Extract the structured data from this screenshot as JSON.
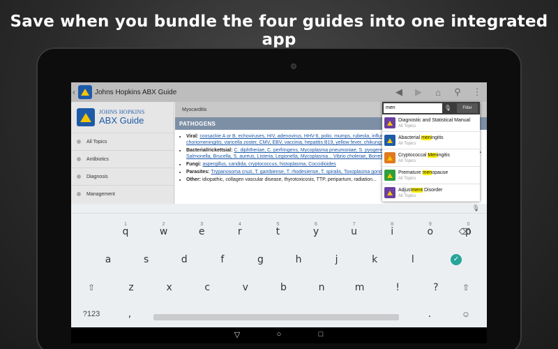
{
  "headline": "Save when you bundle the four guides into one integrated app",
  "appbar": {
    "title": "Johns Hopkins ABX Guide"
  },
  "brand": {
    "line1": "JOHNS HOPKINS",
    "line2": "ABX Guide"
  },
  "sidebar": {
    "items": [
      {
        "label": "All Topics"
      },
      {
        "label": "Antibiotics"
      },
      {
        "label": "Diagnosis"
      },
      {
        "label": "Management"
      }
    ]
  },
  "content": {
    "crumb": "Myocarditis",
    "section": "PATHOGENS",
    "bullets": [
      {
        "label": "Viral:",
        "text": "coxsackie A or B, echoviruses, HIV, adenovirus, HHV-6, polio, mumps, rubeola, influenza, rubella, dengue, lymphocytic choriomeningitis, varicella zoster, CMV, EBV, vaccinia, hepatitis B19, yellow fever, chikungunya virus."
      },
      {
        "label": "Bacterial/rickettsial:",
        "text": "C. diphtheriae, C. perfringens, Mycoplasma pneumoniae, S. pyogenes, R. rickettsii (RMSF Fever), N. meningitidis, Salmonella, Brucella, S. aureus, Listeria, Legionella, Mycoplasma... Vibrio cholerae, Borrelia burgdorferi."
      },
      {
        "label": "Fungi:",
        "text": "aspergillus, candida, cryptococcus, histoplasma, Coccidioides"
      },
      {
        "label": "Parasites:",
        "text": "Trypanosoma cruzi, T. gambiense, T. rhodesiense, T. spiralis, Toxoplasma gondii... migrans"
      },
      {
        "label": "Other:",
        "text": "idiopathic, collagen vascular disease, thyrotoxicosis, TTP, peripartum, radiation..."
      }
    ]
  },
  "search": {
    "query": "men",
    "filter_label": "Filter",
    "results": [
      {
        "pre": "Diagnostic and Statistical Manual",
        "hl": "",
        "post": "",
        "sub": "All Topics",
        "color": "#6a3fa0"
      },
      {
        "pre": "Abacterial ",
        "hl": "men",
        "post": "ingitis",
        "sub": "All Topics",
        "color": "#1e5aa8"
      },
      {
        "pre": "Cryptococcal ",
        "hl": "Men",
        "post": "ingitis",
        "sub": "All Topics",
        "color": "#e07a1f"
      },
      {
        "pre": "Premature ",
        "hl": "men",
        "post": "opause",
        "sub": "All Topics",
        "color": "#2e9e3e"
      },
      {
        "pre": "Adjust",
        "hl": "ment",
        "post": " Disorder",
        "sub": "All Topics",
        "color": "#6a3fa0"
      }
    ]
  },
  "keyboard": {
    "row1": [
      {
        "k": "q",
        "h": "1"
      },
      {
        "k": "w",
        "h": "2"
      },
      {
        "k": "e",
        "h": "3"
      },
      {
        "k": "r",
        "h": "4"
      },
      {
        "k": "t",
        "h": "5"
      },
      {
        "k": "y",
        "h": "6"
      },
      {
        "k": "u",
        "h": "7"
      },
      {
        "k": "i",
        "h": "8"
      },
      {
        "k": "o",
        "h": "9"
      },
      {
        "k": "p",
        "h": "0"
      }
    ],
    "row2": [
      "a",
      "s",
      "d",
      "f",
      "g",
      "h",
      "j",
      "k",
      "l"
    ],
    "row3": [
      "z",
      "x",
      "c",
      "v",
      "b",
      "n",
      "m",
      "!",
      "?"
    ],
    "row3_hints": [
      "",
      "",
      "",
      "",
      "",
      "",
      "",
      "",
      ""
    ],
    "symbols_label": "?123",
    "comma": ",",
    "period": ".",
    "emoji": "☺"
  },
  "colors": {
    "accent": "#1e5aa8",
    "enter": "#26a69a",
    "section": "#7d8fa5"
  }
}
